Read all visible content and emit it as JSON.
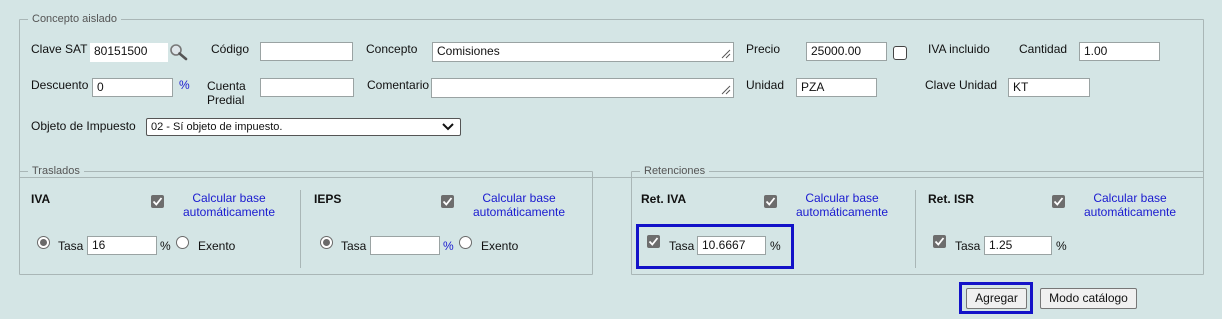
{
  "concepto": {
    "legend": "Concepto aislado",
    "clave_sat_label": "Clave SAT",
    "clave_sat_value": "80151500",
    "codigo_label": "Código",
    "codigo_value": "",
    "concepto_label": "Concepto",
    "concepto_value": "Comisiones",
    "precio_label": "Precio",
    "precio_value": "25000.00",
    "iva_incluido_label": "IVA incluido",
    "cantidad_label": "Cantidad",
    "cantidad_value": "1.00",
    "descuento_label": "Descuento",
    "descuento_value": "0",
    "descuento_unit": "%",
    "cuenta_predial_label_1": "Cuenta",
    "cuenta_predial_label_2": "Predial",
    "cuenta_predial_value": "",
    "comentario_label": "Comentario",
    "comentario_value": "",
    "unidad_label": "Unidad",
    "unidad_value": "PZA",
    "clave_unidad_label": "Clave Unidad",
    "clave_unidad_value": "KT",
    "objeto_label": "Objeto de Impuesto",
    "objeto_selected": "02 - Sí objeto de impuesto."
  },
  "traslados": {
    "legend": "Traslados",
    "iva": {
      "title": "IVA",
      "calc_line1": "Calcular base",
      "calc_line2": "automáticamente",
      "tasa_label": "Tasa",
      "tasa_value": "16",
      "pct": "%",
      "exento_label": "Exento"
    },
    "ieps": {
      "title": "IEPS",
      "calc_line1": "Calcular base",
      "calc_line2": "automáticamente",
      "tasa_label": "Tasa",
      "tasa_value": "",
      "pct": "%",
      "exento_label": "Exento"
    }
  },
  "retenciones": {
    "legend": "Retenciones",
    "ret_iva": {
      "title": "Ret. IVA",
      "calc_line1": "Calcular base",
      "calc_line2": "automáticamente",
      "tasa_label": "Tasa",
      "tasa_value": "10.6667",
      "pct": "%"
    },
    "ret_isr": {
      "title": "Ret. ISR",
      "calc_line1": "Calcular base",
      "calc_line2": "automáticamente",
      "tasa_label": "Tasa",
      "tasa_value": "1.25",
      "pct": "%"
    }
  },
  "buttons": {
    "agregar": "Agregar",
    "modo_catalogo": "Modo catálogo"
  },
  "colors": {
    "background": "#d4e5e5",
    "link": "#1a1ad0",
    "highlight": "#1212c8"
  }
}
